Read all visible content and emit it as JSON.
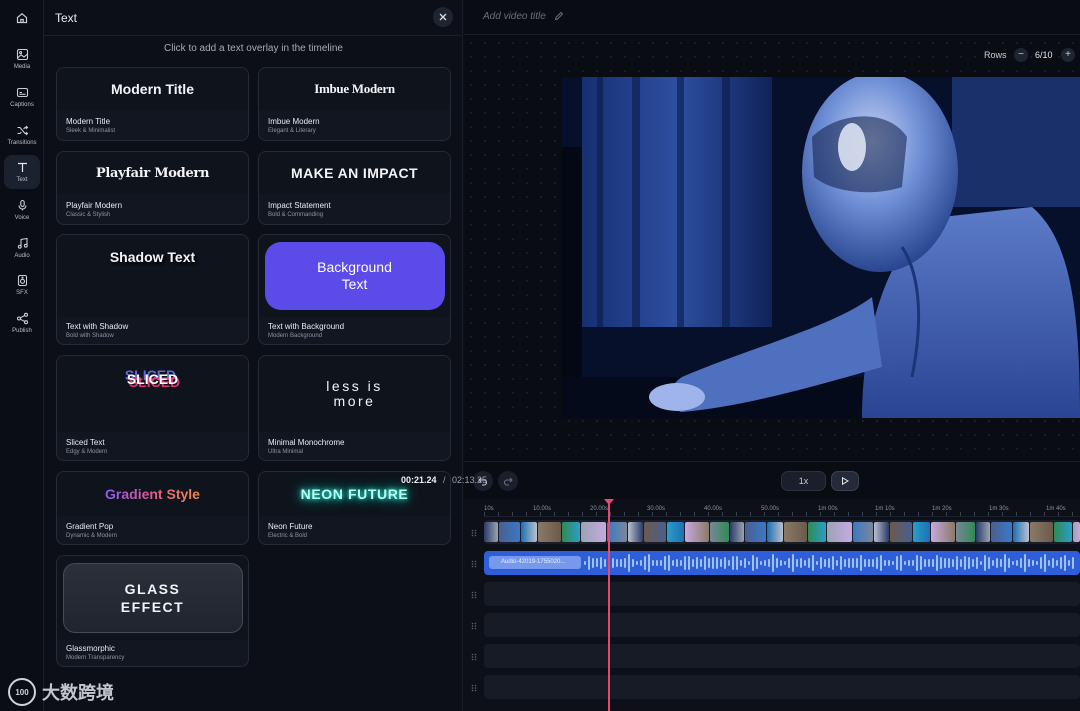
{
  "rail": {
    "items": [
      {
        "label": "Media",
        "icon": "image-icon"
      },
      {
        "label": "Captions",
        "icon": "captions-icon"
      },
      {
        "label": "Transitions",
        "icon": "shuffle-icon"
      },
      {
        "label": "Text",
        "icon": "text-icon",
        "active": true
      },
      {
        "label": "Voice",
        "icon": "microphone-icon"
      },
      {
        "label": "Audio",
        "icon": "music-note-icon"
      },
      {
        "label": "SFX",
        "icon": "speaker-icon"
      },
      {
        "label": "Publish",
        "icon": "share-icon"
      }
    ]
  },
  "panel": {
    "title": "Text",
    "hint": "Click to add a text overlay in the timeline",
    "cards": [
      {
        "preview": "Modern Title",
        "name": "Modern Title",
        "sub": "Sleek & Minimalist"
      },
      {
        "preview": "Imbue Modern",
        "name": "Imbue Modern",
        "sub": "Elegant & Literary"
      },
      {
        "preview": "Playfair Modern",
        "name": "Playfair Modern",
        "sub": "Classic & Stylish"
      },
      {
        "preview": "MAKE AN IMPACT",
        "name": "Impact Statement",
        "sub": "Bold & Commanding"
      },
      {
        "preview": "Shadow Text",
        "name": "Text with Shadow",
        "sub": "Bold with Shadow"
      },
      {
        "preview": "Background Text",
        "name": "Text with Background",
        "sub": "Modern Background"
      },
      {
        "preview": "SLICED",
        "name": "Sliced Text",
        "sub": "Edgy & Modern"
      },
      {
        "preview_line1": "less is",
        "preview_line2": "more",
        "name": "Minimal Monochrome",
        "sub": "Ultra Minimal"
      },
      {
        "preview": "Gradient Style",
        "name": "Gradient Pop",
        "sub": "Dynamic & Modern"
      },
      {
        "preview": "NEON FUTURE",
        "name": "Neon Future",
        "sub": "Electric & Bold"
      },
      {
        "preview_line1": "GLASS",
        "preview_line2": "EFFECT",
        "name": "Glassmorphic",
        "sub": "Modern Transparency"
      }
    ]
  },
  "editor": {
    "title_placeholder": "Add video title",
    "rows_label": "Rows",
    "rows_value": "6/10",
    "speed": "1x",
    "time_current": "00:21.24",
    "time_separator": "/",
    "time_total": "02:13.25",
    "audio_clip_label": "Audio-42019-1755020...",
    "ruler_labels": [
      "10s",
      "10.00s",
      "20.00s",
      "30.00s",
      "40.00s",
      "50.00s",
      "1m 00s",
      "1m 10s",
      "1m 20s",
      "1m 30s",
      "1m 40s"
    ]
  },
  "watermark": {
    "logo_text": "100",
    "text": "大数跨境"
  },
  "colors": {
    "accent": "#5b4be8",
    "playhead": "#e84a6e",
    "audio_track": "#2f5fd8"
  }
}
